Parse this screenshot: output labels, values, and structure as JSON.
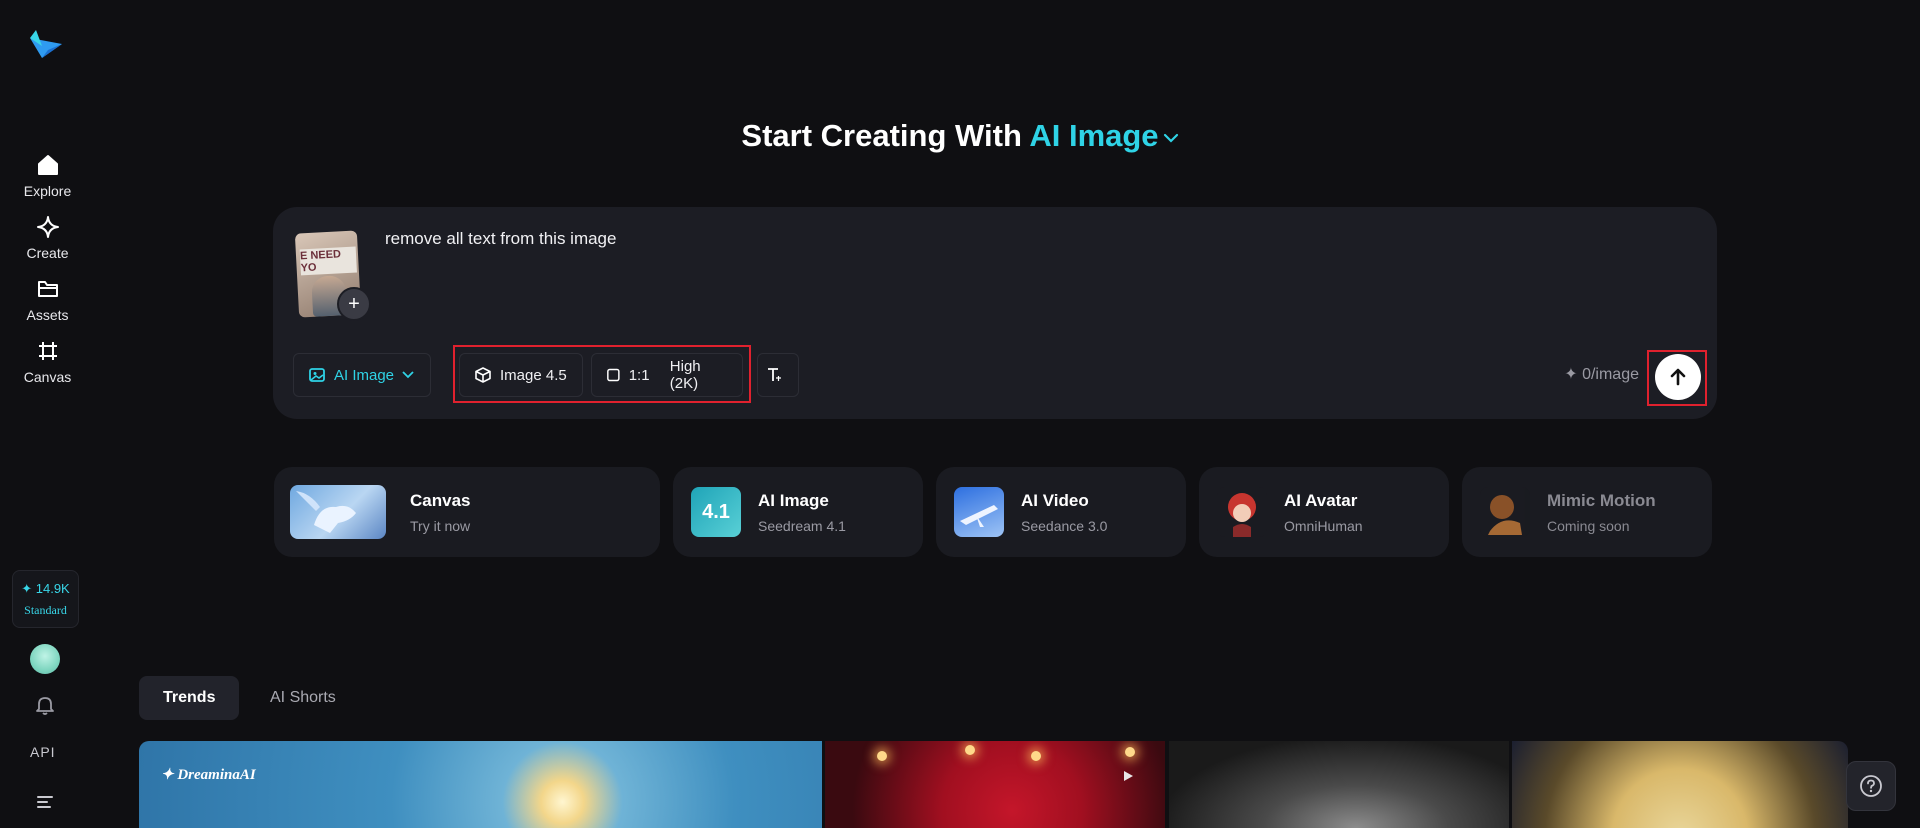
{
  "sidebar": {
    "logo": "dreamina-logo-icon",
    "items": [
      {
        "label": "Explore",
        "icon": "home-icon"
      },
      {
        "label": "Create",
        "icon": "sparkle-diamond-icon"
      },
      {
        "label": "Assets",
        "icon": "folder-icon"
      },
      {
        "label": "Canvas",
        "icon": "canvas-crop-icon"
      }
    ],
    "credits": {
      "amount": "✦ 14.9K",
      "tier": "Standard"
    },
    "api_label": "API"
  },
  "header": {
    "prefix": "Start Creating With",
    "accent": "AI Image"
  },
  "prompt": {
    "text": "remove all text from this image",
    "thumbnail_text": "E NEED YO",
    "add_label": "+"
  },
  "toolbar": {
    "mode_label": "AI Image",
    "model_label": "Image 4.5",
    "ratio_label": "1:1",
    "quality_label": "High (2K)",
    "cost_label": "✦ 0/image"
  },
  "cards": [
    {
      "title": "Canvas",
      "subtitle": "Try it now"
    },
    {
      "title": "AI Image",
      "subtitle": "Seedream 4.1",
      "badge": "4.1"
    },
    {
      "title": "AI Video",
      "subtitle": "Seedance 3.0"
    },
    {
      "title": "AI Avatar",
      "subtitle": "OmniHuman"
    },
    {
      "title": "Mimic Motion",
      "subtitle": "Coming soon"
    }
  ],
  "tabs": [
    {
      "label": "Trends",
      "active": true
    },
    {
      "label": "AI Shorts",
      "active": false
    }
  ],
  "gallery": {
    "watermark": "DreaminaAI"
  },
  "colors": {
    "accent": "#2fd3e6",
    "highlight": "#e0212e",
    "background": "#0f0f12",
    "panel": "#1c1d24"
  }
}
